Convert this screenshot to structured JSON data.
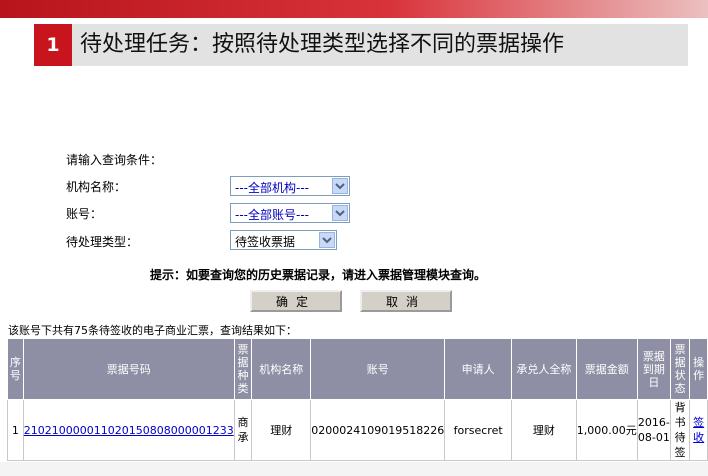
{
  "slide": {
    "number": "1",
    "title": "待处理任务：按照待处理类型选择不同的票据操作"
  },
  "form": {
    "prompt": "请输入查询条件：",
    "org_label": "机构名称：",
    "org_value": "---全部机构---",
    "account_label": "账号：",
    "account_value": "---全部账号---",
    "type_label": "待处理类型：",
    "type_value": "待签收票据"
  },
  "hint": "提示：如要查询您的历史票据记录，请进入票据管理模块查询。",
  "buttons": {
    "confirm": "确定",
    "cancel": "取消"
  },
  "summary": "该账号下共有75条待签收的电子商业汇票，查询结果如下：",
  "table": {
    "headers": [
      "序号",
      "票据号码",
      "票据种类",
      "机构名称",
      "账号",
      "申请人",
      "承兑人全称",
      "票据金额",
      "票据到期日",
      "票据状态",
      "操作"
    ],
    "rows": [
      {
        "index": "1",
        "bill_no": "210210000011020150808000001233",
        "bill_type": "商承",
        "org": "理财",
        "account": "0200024109019518226",
        "applicant": "forsecret",
        "acceptor": "理财",
        "amount": "1,000.00元",
        "due_date": "2016-08-01",
        "status": "背书待签",
        "action": "签收"
      }
    ]
  },
  "colors": {
    "accent": "#c8141c",
    "header_bg": "#8e8fa4"
  }
}
